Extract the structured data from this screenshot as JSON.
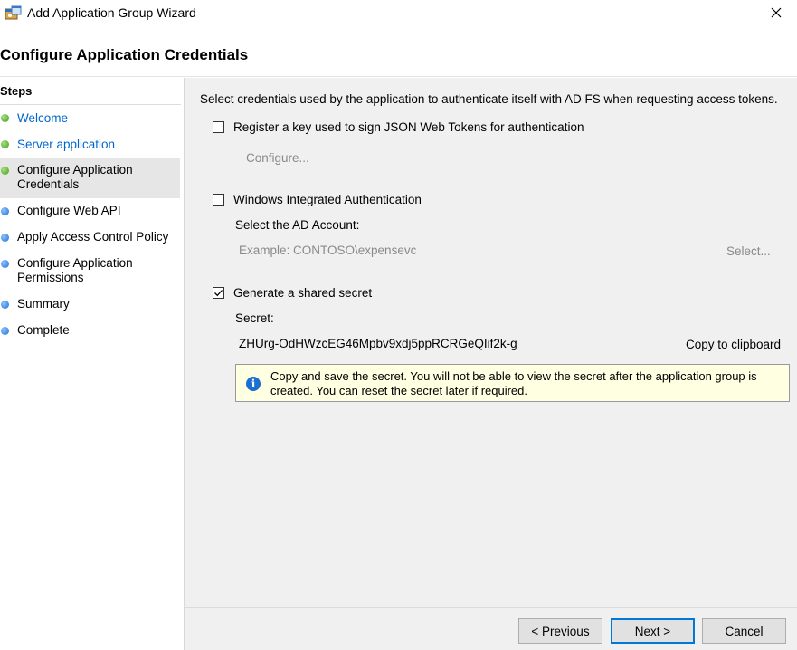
{
  "window": {
    "title": "Add Application Group Wizard",
    "icon": "app-group-icon",
    "close_icon": "close-icon"
  },
  "page_title": "Configure Application Credentials",
  "steps": {
    "title": "Steps",
    "items": [
      {
        "label": "Welcome",
        "state": "completed",
        "dot_color": "#3fa11d"
      },
      {
        "label": "Server application",
        "state": "completed",
        "dot_color": "#3fa11d"
      },
      {
        "label": "Configure Application Credentials",
        "state": "current",
        "dot_color": "#3fa11d"
      },
      {
        "label": "Configure Web API",
        "state": "pending",
        "dot_color": "#1e6fd9"
      },
      {
        "label": "Apply Access Control Policy",
        "state": "pending",
        "dot_color": "#1e6fd9"
      },
      {
        "label": "Configure Application Permissions",
        "state": "pending",
        "dot_color": "#1e6fd9"
      },
      {
        "label": "Summary",
        "state": "pending",
        "dot_color": "#1e6fd9"
      },
      {
        "label": "Complete",
        "state": "pending",
        "dot_color": "#1e6fd9"
      }
    ]
  },
  "content": {
    "instruction": "Select credentials used by the application to authenticate itself with AD FS when requesting access tokens.",
    "jwt_option": {
      "label": "Register a key used to sign JSON Web Tokens for authentication",
      "checked": false,
      "configure_label": "Configure..."
    },
    "wia_option": {
      "label": "Windows Integrated Authentication",
      "checked": false,
      "account_label": "Select the AD Account:",
      "account_placeholder": "Example: CONTOSO\\expensevc",
      "select_label": "Select..."
    },
    "secret_option": {
      "label": "Generate a shared secret",
      "checked": true,
      "secret_label": "Secret:",
      "secret_value": "ZHUrg-OdHWzcEG46Mpbv9xdj5ppRCRGeQIif2k-g",
      "copy_label": "Copy to clipboard"
    },
    "info": {
      "icon": "info-icon",
      "text": "Copy and save the secret.  You will not be able to view the secret after the application group is created.  You can reset the secret later if required."
    }
  },
  "footer": {
    "previous_label": "< Previous",
    "next_label": "Next >",
    "cancel_label": "Cancel"
  },
  "colors": {
    "accent": "#0078d7",
    "link": "#0066cc",
    "info_background": "#ffffe1",
    "content_background": "#f0f0f0"
  }
}
